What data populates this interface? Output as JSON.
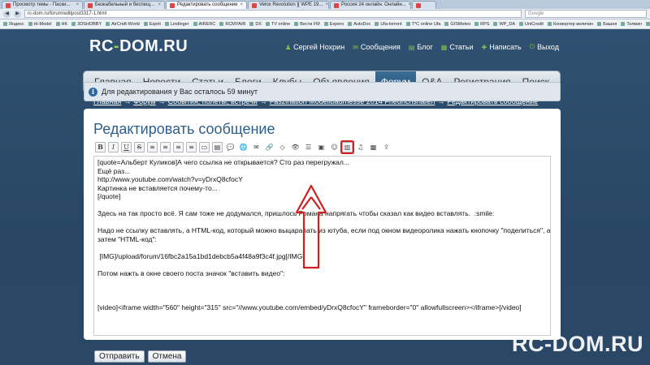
{
  "browser": {
    "tabs": [
      {
        "label": "Просмотр темы - Паски...",
        "active": false
      },
      {
        "label": "Безкабельный и беспещ...",
        "active": false
      },
      {
        "label": "Редактировать сообщение",
        "active": true
      },
      {
        "label": "Velox Revolution ][ WPE 19...",
        "active": false
      },
      {
        "label": "Россия 24 онлайн. Онлайн...",
        "active": false
      },
      {
        "label": "",
        "active": false
      }
    ],
    "url": "rc-dom.ru/forum/editpost3317-1.html",
    "search_placeholder": "Google",
    "bookmarks": [
      "Яндекс",
      "Hi-Model",
      "HK",
      "3DSHOBBY",
      "AirCraft-World",
      "Esprit",
      "Lindinger",
      "AIRERC",
      "RCMYAIR",
      "DX",
      "TV online",
      "Вести FM",
      "Expero",
      "AutoDoc",
      "Ufa-torrent",
      "T*C online Ufa",
      "GISMeteo",
      "RPS",
      "WP_DA",
      "UniCredit",
      "Конвертер величин",
      "Башня",
      "Толмач",
      "D-Link"
    ]
  },
  "site": {
    "logo_main": "RC",
    "logo_dash": "-",
    "logo_tld": "DOM.RU",
    "user_links": [
      {
        "icon": "user-icon",
        "label": "Сергей Нохрин"
      },
      {
        "icon": "envelope-icon",
        "label": "Сообщения"
      },
      {
        "icon": "blog-icon",
        "label": "Блог"
      },
      {
        "icon": "articles-icon",
        "label": "Статьи"
      },
      {
        "icon": "write-icon",
        "label": "Написать"
      },
      {
        "icon": "logout-icon",
        "label": "Выход"
      }
    ],
    "nav": [
      {
        "label": "Главная",
        "active": false
      },
      {
        "label": "Новости",
        "active": false
      },
      {
        "label": "Статьи",
        "active": false
      },
      {
        "label": "Блоги",
        "active": false
      },
      {
        "label": "Клубы",
        "active": false
      },
      {
        "label": "Объявления",
        "active": false
      },
      {
        "label": "Форум",
        "active": true
      },
      {
        "label": "Q&A",
        "active": false
      },
      {
        "label": "Регистрация",
        "active": false
      },
      {
        "label": "Поиск",
        "active": false
      }
    ],
    "breadcrumb": [
      "Главная",
      "Форум",
      "События, полеты, встречи",
      "Faszination Modellbaumesse 2014 Friedrichshafen",
      "Редактировать сообщение"
    ],
    "breadcrumb_sep": "→",
    "notice": "Для редактирования у Вас осталось 59 минут"
  },
  "editor": {
    "title": "Редактировать сообщение",
    "toolbar": [
      {
        "name": "bold-icon",
        "glyph": "B"
      },
      {
        "name": "italic-icon",
        "glyph": "I"
      },
      {
        "name": "underline-icon",
        "glyph": "U"
      },
      {
        "name": "strikethrough-icon",
        "glyph": "S"
      },
      {
        "name": "align-left-icon",
        "glyph": "≡"
      },
      {
        "name": "align-center-icon",
        "glyph": "≡"
      },
      {
        "name": "align-right-icon",
        "glyph": "≡"
      },
      {
        "name": "justify-icon",
        "glyph": "≡"
      },
      {
        "name": "code-icon",
        "glyph": "▭"
      },
      {
        "name": "spoiler-icon",
        "glyph": "▤"
      },
      {
        "name": "quote-icon",
        "glyph": "💬"
      },
      {
        "name": "globe-icon",
        "glyph": "🌐"
      },
      {
        "name": "email-icon",
        "glyph": "✉"
      },
      {
        "name": "link-icon",
        "glyph": "🔗"
      },
      {
        "name": "html-icon",
        "glyph": "◇"
      },
      {
        "name": "preview-icon",
        "glyph": "👁"
      },
      {
        "name": "list-icon",
        "glyph": "☰"
      },
      {
        "name": "image-icon",
        "glyph": "▣"
      },
      {
        "name": "smiley-icon",
        "glyph": "☺"
      },
      {
        "name": "video-icon",
        "glyph": "▥"
      },
      {
        "name": "music-icon",
        "glyph": "♫"
      },
      {
        "name": "picture-icon",
        "glyph": "▩"
      },
      {
        "name": "upload-icon",
        "glyph": "⇪"
      }
    ],
    "highlighted_tool": "video-icon",
    "lines": [
      "[quote=Альберт Куликов]А чего ссылка не открывается? Сто раз перегружал...",
      "Ещё раз...",
      "http://www.youtube.com/watch?v=yDrxQ8cfocY",
      "Картинка не вставляется почему-то...",
      "[/quote]",
      "",
      "Здесь на так просто всё. Я сам тоже не додумался, пришлось Романа напрягать чтобы сказал как видео вставлять.  :smile:",
      "",
      "Надо не ссылку вставлять, а HTML-код, который можно выцарапать из ютуба, если под окном видеоролика нажать кнопочку \"поделиться\", а",
      "затем \"HTML-код\":",
      "",
      " [IMG]/upload/forum/16fbc2a15a1bd1debcb5a4f48a9f3c4f.jpg[/IMG]",
      "",
      "Потом нажть в окне своего поста значок \"вставить видео\":",
      "",
      "",
      "",
      "[video]<iframe width=\"560\" height=\"315\" src=\"//www.youtube.com/embed/yDrxQ8cfocY\" frameborder=\"0\" allowfullscreen></iframe>[/video]"
    ],
    "submit_label": "Отправить",
    "cancel_label": "Отмена"
  },
  "watermark": "RC-DOM.RU",
  "colors": {
    "accent": "#2e5f8a",
    "logo_dash": "#8fd14f",
    "annotation": "#d02020",
    "background": "#2b4a68"
  }
}
